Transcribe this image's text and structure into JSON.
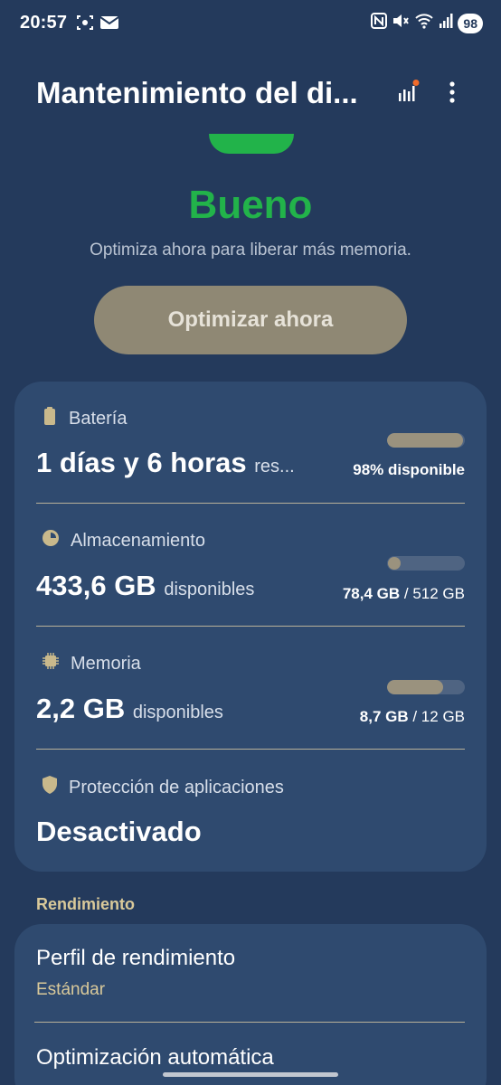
{
  "status_bar": {
    "time": "20:57",
    "battery": "98"
  },
  "header": {
    "title": "Mantenimiento del di..."
  },
  "status": {
    "word": "Bueno",
    "subtitle": "Optimiza ahora para liberar más memoria.",
    "optimize_button": "Optimizar ahora",
    "color": "#22b34a"
  },
  "battery_row": {
    "title": "Batería",
    "value": "1 días y 6 horas",
    "suffix": "res...",
    "percent": "98%",
    "percent_label": "disponible",
    "level": 0.98
  },
  "storage_row": {
    "title": "Almacenamiento",
    "value": "433,6 GB",
    "suffix": "disponibles",
    "used": "78,4 GB",
    "total": "/ 512 GB",
    "level": 0.153
  },
  "memory_row": {
    "title": "Memoria",
    "value": "2,2 GB",
    "suffix": "disponibles",
    "used": "8,7 GB",
    "total": "/ 12 GB",
    "level": 0.725
  },
  "protection_row": {
    "title": "Protección de aplicaciones",
    "value": "Desactivado"
  },
  "performance": {
    "section_label": "Rendimiento",
    "profile_title": "Perfil de rendimiento",
    "profile_value": "Estándar",
    "auto_title": "Optimización automática"
  },
  "icons": [
    "screenshot-icon",
    "mail-icon",
    "nfc-icon",
    "mute-icon",
    "wifi-icon",
    "signal-icon",
    "stats-icon",
    "more-vert-icon",
    "battery-icon",
    "storage-pie-icon",
    "chip-icon",
    "shield-icon"
  ]
}
